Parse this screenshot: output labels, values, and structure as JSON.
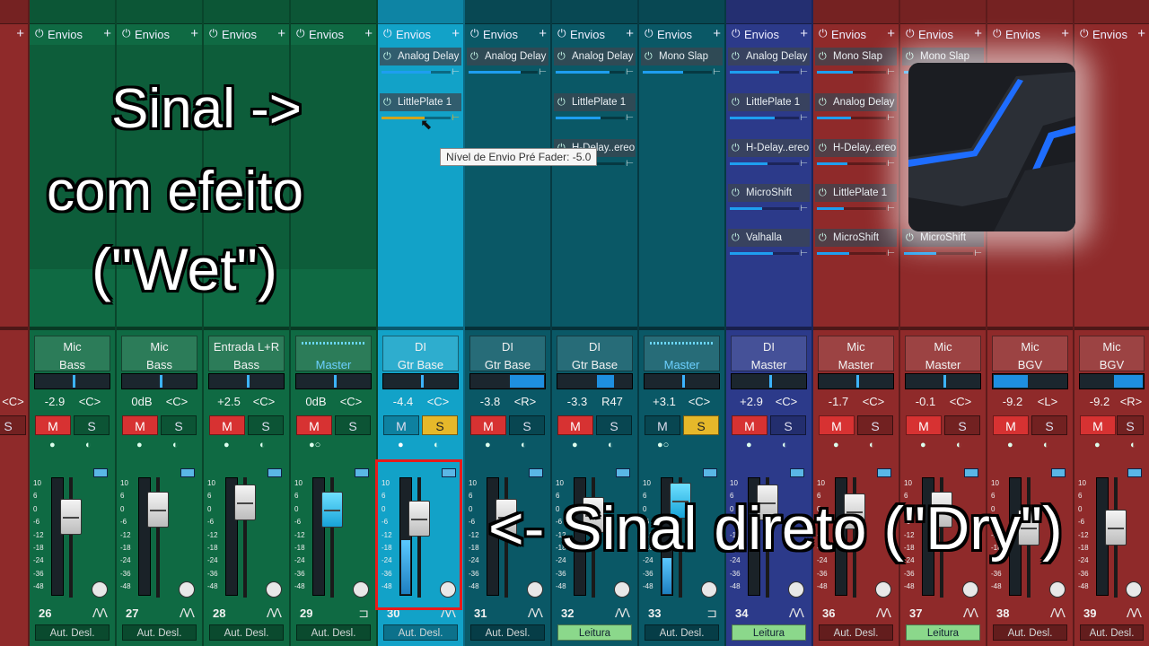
{
  "sends_label": "Envios",
  "tooltip": "Nível de Envio Pré Fader: -5.0",
  "captions": {
    "wet_line1": "Sinal  ->",
    "wet_line2": "com  efeito",
    "wet_line3": "(\"Wet\")",
    "dry": "<- Sinal direto (\"Dry\")"
  },
  "scale_labels": [
    "10",
    "6",
    "0",
    "-6",
    "-12",
    "-18",
    "-24",
    "-36",
    "-48"
  ],
  "colors": {
    "green": "#0f6a43",
    "cyan": "#12a2c8",
    "teal": "#0a5866",
    "purple": "#2c3a8a",
    "red": "#8f2a2a",
    "mute_on": "#d73232",
    "solo_on": "#e6b82a",
    "send_level": "#1e9ef0",
    "highlight_box": "#e81b1b"
  },
  "leftpartial": {
    "vol": "r",
    "pan": "<C>",
    "solo": "S"
  },
  "strips": [
    {
      "num": "26",
      "line1": "Mic",
      "line2": "Bass",
      "vol": "-2.9",
      "pan": "<C>",
      "mute": "M",
      "solo": "S",
      "mute_on": true,
      "solo_on": false,
      "auto": "Aut. Desl.",
      "sends": []
    },
    {
      "num": "27",
      "line1": "Mic",
      "line2": "Bass",
      "vol": "0dB",
      "pan": "<C>",
      "mute": "M",
      "solo": "S",
      "mute_on": true,
      "solo_on": false,
      "auto": "Aut. Desl.",
      "sends": []
    },
    {
      "num": "28",
      "line1": "Entrada L+R",
      "line2": "Bass",
      "vol": "+2.5",
      "pan": "<C>",
      "mute": "M",
      "solo": "S",
      "mute_on": true,
      "solo_on": false,
      "auto": "Aut. Desl.",
      "sends": []
    },
    {
      "num": "29",
      "line1": "",
      "line2": "Master",
      "vol": "0dB",
      "pan": "<C>",
      "mute": "M",
      "solo": "S",
      "mute_on": true,
      "solo_on": false,
      "auto": "Aut. Desl.",
      "sends": []
    },
    {
      "num": "30",
      "line1": "DI",
      "line2": "Gtr Base",
      "vol": "-4.4",
      "pan": "<C>",
      "mute": "M",
      "solo": "S",
      "mute_on": false,
      "solo_on": true,
      "auto": "Aut. Desl.",
      "sends": [
        "Analog Delay",
        "LittlePlate 1"
      ]
    },
    {
      "num": "31",
      "line1": "DI",
      "line2": "Gtr Base",
      "vol": "-3.8",
      "pan": "<R>",
      "mute": "M",
      "solo": "S",
      "mute_on": true,
      "solo_on": false,
      "auto": "Aut. Desl.",
      "sends": [
        "Analog Delay"
      ]
    },
    {
      "num": "32",
      "line1": "DI",
      "line2": "Gtr Base",
      "vol": "-3.3",
      "pan": "R47",
      "mute": "M",
      "solo": "S",
      "mute_on": true,
      "solo_on": false,
      "auto": "Leitura",
      "sends": [
        "Analog Delay",
        "LittlePlate 1",
        "H-Delay..ereo"
      ]
    },
    {
      "num": "33",
      "line1": "",
      "line2": "Master",
      "vol": "+3.1",
      "pan": "<C>",
      "mute": "M",
      "solo": "S",
      "mute_on": false,
      "solo_on": true,
      "auto": "Aut. Desl.",
      "sends": [
        "Mono Slap"
      ]
    },
    {
      "num": "34",
      "line1": "DI",
      "line2": "Master",
      "vol": "+2.9",
      "pan": "<C>",
      "mute": "M",
      "solo": "S",
      "mute_on": true,
      "solo_on": false,
      "auto": "Leitura",
      "sends": [
        "Analog Delay",
        "LittlePlate 1",
        "H-Delay..ereo",
        "MicroShift",
        "Valhalla"
      ]
    },
    {
      "num": "36",
      "line1": "Mic",
      "line2": "Master",
      "vol": "-1.7",
      "pan": "<C>",
      "mute": "M",
      "solo": "S",
      "mute_on": true,
      "solo_on": false,
      "auto": "Aut. Desl.",
      "sends": [
        "Mono Slap",
        "Analog Delay",
        "H-Delay..ereo",
        "LittlePlate 1",
        "MicroShift"
      ]
    },
    {
      "num": "37",
      "line1": "Mic",
      "line2": "Master",
      "vol": "-0.1",
      "pan": "<C>",
      "mute": "M",
      "solo": "S",
      "mute_on": true,
      "solo_on": false,
      "auto": "Leitura",
      "sends": [
        "Mono Slap",
        "",
        "",
        "",
        "MicroShift"
      ]
    },
    {
      "num": "38",
      "line1": "Mic",
      "line2": "BGV",
      "vol": "-9.2",
      "pan": "<L>",
      "mute": "M",
      "solo": "S",
      "mute_on": true,
      "solo_on": false,
      "auto": "Aut. Desl.",
      "sends": []
    },
    {
      "num": "39",
      "line1": "Mic",
      "line2": "BGV",
      "vol": "-9.2",
      "pan": "<R>",
      "mute": "M",
      "solo": "S",
      "mute_on": true,
      "solo_on": false,
      "auto": "Aut. Desl.",
      "sends": []
    }
  ]
}
